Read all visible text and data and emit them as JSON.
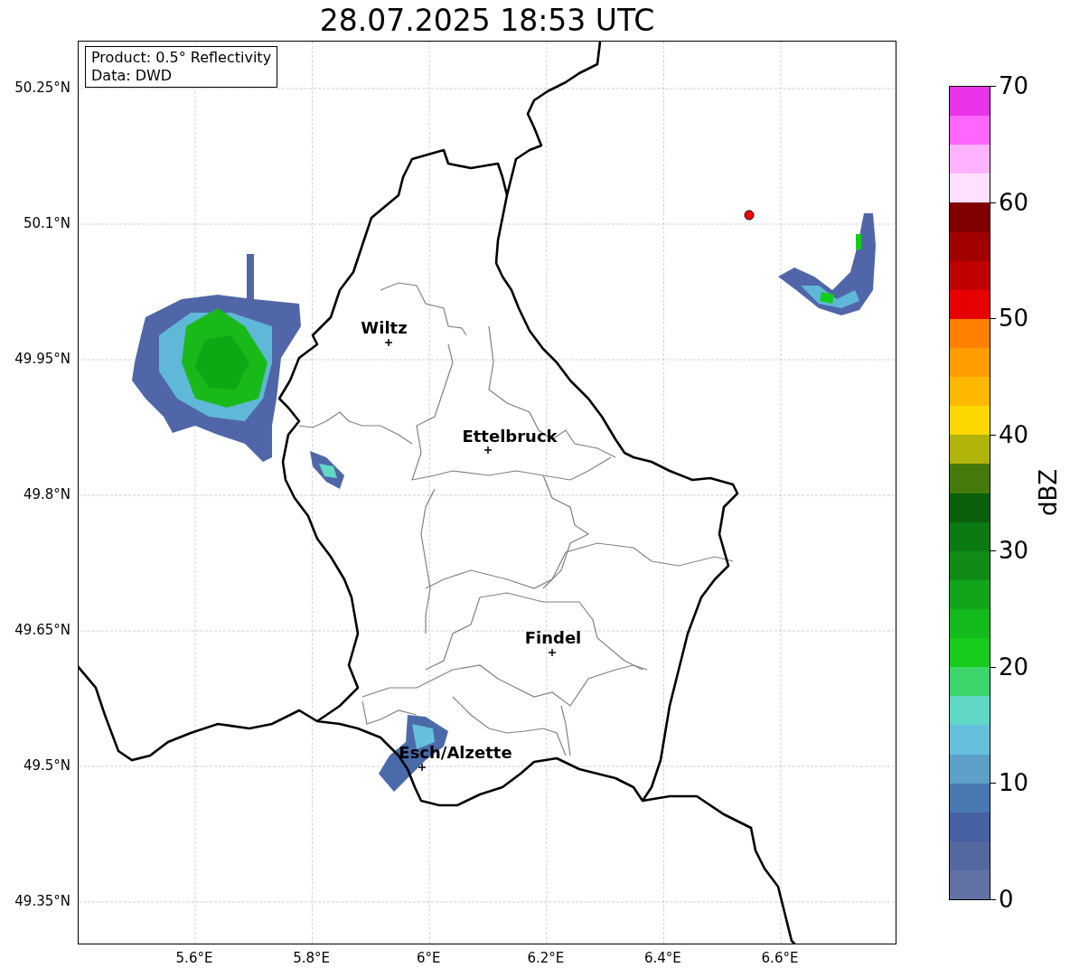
{
  "title": "28.07.2025 18:53 UTC",
  "info_box": {
    "lines": [
      "Product: 0.5° Reflectivity",
      "Data: DWD"
    ]
  },
  "map": {
    "yticks": [
      "50.25°N",
      "50.1°N",
      "49.95°N",
      "49.8°N",
      "49.65°N",
      "49.5°N",
      "49.35°N"
    ],
    "xticks": [
      "5.6°E",
      "5.8°E",
      "6°E",
      "6.2°E",
      "6.4°E",
      "6.6°E"
    ],
    "places": [
      {
        "label": "Wiltz"
      },
      {
        "label": "Ettelbruck"
      },
      {
        "label": "Findel"
      },
      {
        "label": "Esch/Alzette"
      }
    ]
  },
  "colorbar": {
    "label": "dBZ",
    "ticks": [
      "70",
      "60",
      "50",
      "40",
      "30",
      "20",
      "10",
      "0"
    ],
    "bins": [
      {
        "color": "#e933e9"
      },
      {
        "color": "#ff66ff"
      },
      {
        "color": "#ffb3ff"
      },
      {
        "color": "#ffe0ff"
      },
      {
        "color": "#800000"
      },
      {
        "color": "#a00000"
      },
      {
        "color": "#c00000"
      },
      {
        "color": "#e60000"
      },
      {
        "color": "#ff8000"
      },
      {
        "color": "#ff9c00"
      },
      {
        "color": "#ffb800"
      },
      {
        "color": "#ffd700"
      },
      {
        "color": "#b0b30a"
      },
      {
        "color": "#467a0c"
      },
      {
        "color": "#0a5f0d"
      },
      {
        "color": "#0c7a12"
      },
      {
        "color": "#108c16"
      },
      {
        "color": "#12a51a"
      },
      {
        "color": "#14bb1c"
      },
      {
        "color": "#16cc1b"
      },
      {
        "color": "#3dd66c"
      },
      {
        "color": "#60d8c4"
      },
      {
        "color": "#66c0dc"
      },
      {
        "color": "#5ca0c8"
      },
      {
        "color": "#4a78b0"
      },
      {
        "color": "#4560a3"
      },
      {
        "color": "#5468a0"
      },
      {
        "color": "#6272a4"
      }
    ]
  }
}
